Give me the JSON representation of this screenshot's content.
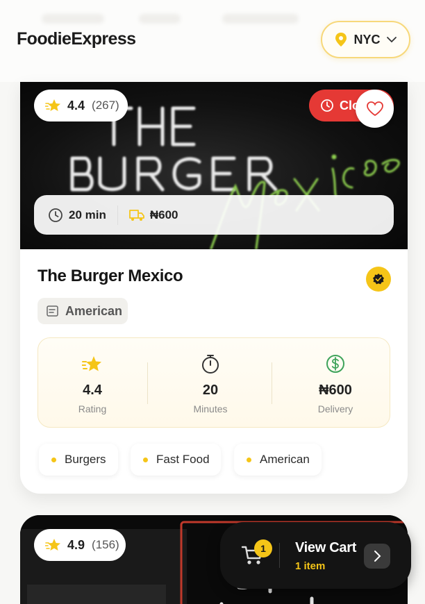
{
  "header": {
    "logo": "FoodieExpress",
    "location": {
      "label": "NYC",
      "icon": "location-pin-icon",
      "chevron": "chevron-down-icon"
    }
  },
  "restaurant": {
    "name": "The Burger Mexico",
    "rating": "4.4",
    "review_count": "(267)",
    "status_label": "Closed",
    "delivery_time": "20 min",
    "delivery_fee": "₦600",
    "cuisine": "American",
    "stats": [
      {
        "value": "4.4",
        "caption": "Rating",
        "icon": "star-icon"
      },
      {
        "value": "20",
        "caption": "Minutes",
        "icon": "stopwatch-icon"
      },
      {
        "value": "₦600",
        "caption": "Delivery",
        "icon": "dollar-icon"
      }
    ],
    "tags": [
      "Burgers",
      "Fast Food",
      "American"
    ]
  },
  "next_restaurant": {
    "rating": "4.9",
    "review_count": "(156)"
  },
  "cart": {
    "count": "1",
    "title": "View Cart",
    "subtitle": "1 item"
  },
  "colors": {
    "accent": "#f5c518",
    "closed": "#e53935",
    "neon": "#8fd14f"
  }
}
